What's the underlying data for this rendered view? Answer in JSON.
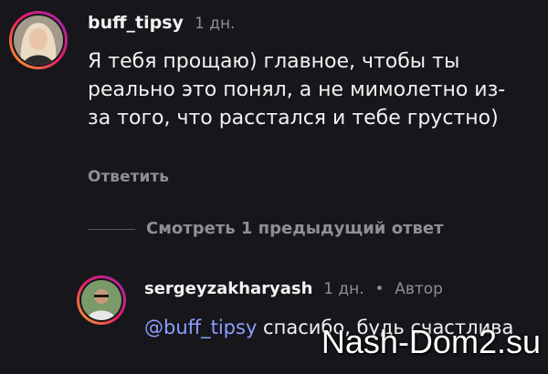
{
  "comment": {
    "username": "buff_tipsy",
    "time": "1 дн.",
    "text": "Я тебя прощаю) главное, чтобы ты реально это понял, а не мимолетно из-за того, что расстался и тебе грустно)",
    "reply_label": "Ответить"
  },
  "view_more_label": "Смотреть 1 предыдущий ответ",
  "reply": {
    "username": "sergeyzakharyash",
    "time": "1 дн.",
    "separator": "•",
    "author_badge": "Автор",
    "mention": "@buff_tipsy",
    "text": " спасибо, будь счастлива"
  },
  "watermark": "Nash-Dom2.su",
  "colors": {
    "background": "#16161b",
    "mention": "#8c9eff",
    "meta": "#8e8e93"
  }
}
